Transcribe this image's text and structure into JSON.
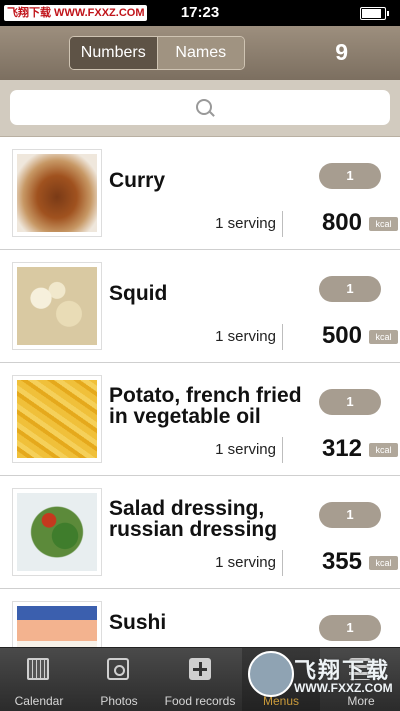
{
  "status_bar": {
    "time": "17:23",
    "watermark": "飞翔下载 WWW.FXXZ.COM",
    "battery_level": 0.85
  },
  "header": {
    "segments": [
      {
        "label": "Numbers",
        "selected": true
      },
      {
        "label": "Names",
        "selected": false
      }
    ],
    "count": "9"
  },
  "search": {
    "value": "",
    "placeholder": ""
  },
  "items": [
    {
      "name": "Curry",
      "quantity": "1",
      "serving": "1 serving",
      "kcal": "800",
      "unit": "kcal"
    },
    {
      "name": "Squid",
      "quantity": "1",
      "serving": "1 serving",
      "kcal": "500",
      "unit": "kcal"
    },
    {
      "name": "Potato, french fried in vegetable oil",
      "quantity": "1",
      "serving": "1 serving",
      "kcal": "312",
      "unit": "kcal"
    },
    {
      "name": "Salad dressing, russian dressing",
      "quantity": "1",
      "serving": "1 serving",
      "kcal": "355",
      "unit": "kcal"
    },
    {
      "name": "Sushi",
      "quantity": "1"
    }
  ],
  "tabs": [
    {
      "label": "Calendar",
      "icon": "calendar-icon"
    },
    {
      "label": "Photos",
      "icon": "photo-icon"
    },
    {
      "label": "Food records",
      "icon": "add-icon"
    },
    {
      "label": "Menus",
      "icon": "menu-icon",
      "selected": true
    },
    {
      "label": "More",
      "icon": "more-icon"
    }
  ],
  "overlay_watermark": {
    "chinese": "飞翔下载",
    "url": "WWW.FXXZ.COM"
  },
  "colors": {
    "header": "#8a7d6c",
    "accent": "#c99a3a",
    "pill": "#a79d90"
  }
}
